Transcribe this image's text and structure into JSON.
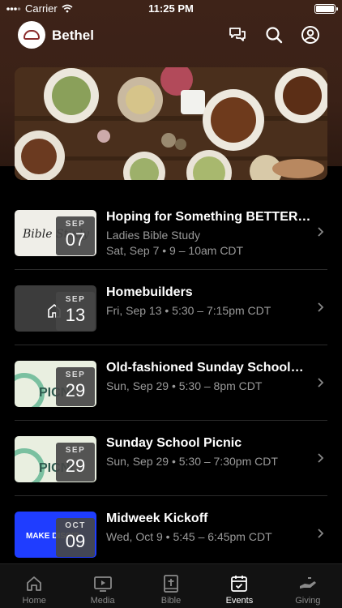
{
  "status_bar": {
    "carrier": "Carrier",
    "time": "11:25 PM"
  },
  "header": {
    "church_name": "Bethel"
  },
  "hero": {
    "icon": "food-table-photo"
  },
  "events": [
    {
      "title": "Hoping for Something BETTER…",
      "subtitle": "Ladies Bible Study",
      "when": "Sat, Sep 7 • 9 – 10am CDT",
      "month": "SEP",
      "day": "07",
      "thumb": "bible-study-art",
      "thumb_text": "Bible Study"
    },
    {
      "title": "Homebuilders",
      "when": "Fri, Sep 13 • 5:30 – 7:15pm CDT",
      "month": "SEP",
      "day": "13",
      "thumb": "house-icon"
    },
    {
      "title": "Old-fashioned Sunday School…",
      "when": "Sun, Sep 29 • 5:30 – 8pm CDT",
      "month": "SEP",
      "day": "29",
      "thumb": "picnic-art",
      "thumb_text": "PICNI"
    },
    {
      "title": "Sunday School Picnic",
      "when": "Sun, Sep 29 • 5:30 – 7:30pm CDT",
      "month": "SEP",
      "day": "29",
      "thumb": "picnic-art",
      "thumb_text": "PICNI"
    },
    {
      "title": "Midweek Kickoff",
      "when": "Wed, Oct 9 • 5:45 – 6:45pm CDT",
      "month": "OCT",
      "day": "09",
      "thumb": "make-disciples-art",
      "thumb_text": "MAKE DISCIP"
    }
  ],
  "tabs": [
    {
      "label": "Home",
      "icon": "home-icon",
      "active": false
    },
    {
      "label": "Media",
      "icon": "play-icon",
      "active": false
    },
    {
      "label": "Bible",
      "icon": "bible-icon",
      "active": false
    },
    {
      "label": "Events",
      "icon": "calendar-icon",
      "active": true
    },
    {
      "label": "Giving",
      "icon": "giving-hand-icon",
      "active": false
    }
  ],
  "colors": {
    "header_brown": "#3e2318",
    "background": "#000000",
    "tab_active": "#ffffff",
    "tab_inactive": "#8a8a8a",
    "picnic_green": "#2e5a4e",
    "disciple_blue": "#1f3dff"
  }
}
